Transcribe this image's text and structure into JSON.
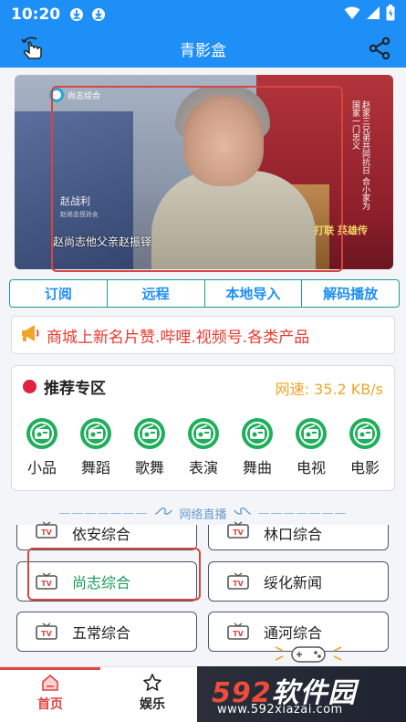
{
  "status_bar": {
    "time": "10:20",
    "icons": [
      "download-icon",
      "download-icon",
      "wifi-icon",
      "signal-icon",
      "battery-icon"
    ]
  },
  "header": {
    "title": "青影盒",
    "back_icon": "back-gesture-icon",
    "share_icon": "share-icon"
  },
  "video": {
    "channel_logo_text": "尚志综合",
    "side_text": "赵家三兄弟共同抗日 合小家为国家一门忠义",
    "name_tag": "赵战利",
    "name_tag_sub": "赵尚志侄孙女",
    "subtitle": "赵尚志他父亲赵振铎",
    "corner_logo": "打联 英雄传"
  },
  "tabs": [
    "订阅",
    "远程",
    "本地导入",
    "解码播放"
  ],
  "marquee": {
    "icon": "megaphone-icon",
    "text": "商城上新名片赞.哔哩.视频号.各类产品"
  },
  "recommend": {
    "title": "推荐专区",
    "speed": "网速: 35.2 KB/s",
    "categories": [
      "小品",
      "舞蹈",
      "歌舞",
      "表演",
      "舞曲",
      "电视",
      "电影"
    ]
  },
  "live": {
    "title": "网络直播",
    "channels": [
      {
        "name": "依安综合"
      },
      {
        "name": "林口综合"
      },
      {
        "name": "尚志综合"
      },
      {
        "name": "绥化新闻"
      },
      {
        "name": "五常综合"
      },
      {
        "name": "通河综合"
      }
    ]
  },
  "bottom_nav": {
    "home": "首页",
    "entertainment": "娱乐"
  },
  "watermark": {
    "brand_num": "592",
    "brand_text": "软件园",
    "url": "www.592xiazai.com"
  },
  "colors": {
    "primary": "#1e8ff6",
    "tab_border": "#1a9d8f",
    "accent_red": "#e04343",
    "speed": "#f0a526",
    "green": "#1a9a5a"
  }
}
